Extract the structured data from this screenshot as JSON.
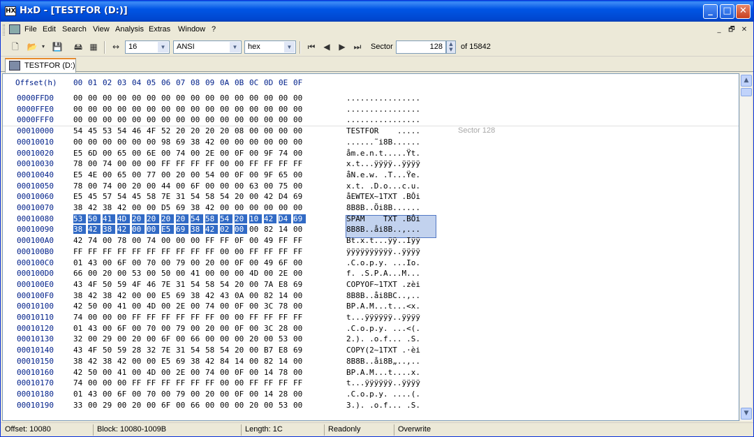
{
  "window": {
    "title": "HxD - [TESTFOR (D:)]",
    "icon": "hxd-icon",
    "app_icon_text": "HX"
  },
  "window_controls": {
    "minimize": "_",
    "maximize": "□",
    "close": "✕"
  },
  "menu": [
    "File",
    "Edit",
    "Search",
    "View",
    "Analysis",
    "Extras",
    "Window",
    "?"
  ],
  "mdi_controls": {
    "minimize": "_",
    "restore": "🗗",
    "close": "✕"
  },
  "toolbar": {
    "bytes_per_row": "16",
    "charset": "ANSI",
    "offset_base": "hex",
    "sector_label": "Sector",
    "sector_value": "128",
    "sector_total": "of 15842"
  },
  "tab": {
    "label": "TESTFOR (D:)"
  },
  "hex": {
    "offset_header": "Offset(h)",
    "columns": [
      "00",
      "01",
      "02",
      "03",
      "04",
      "05",
      "06",
      "07",
      "08",
      "09",
      "0A",
      "0B",
      "0C",
      "0D",
      "0E",
      "0F"
    ],
    "sector_marker": "Sector 128",
    "rows": [
      {
        "offset": "0000FFD0",
        "bytes": [
          "00",
          "00",
          "00",
          "00",
          "00",
          "00",
          "00",
          "00",
          "00",
          "00",
          "00",
          "00",
          "00",
          "00",
          "00",
          "00"
        ],
        "ascii": "................"
      },
      {
        "offset": "0000FFE0",
        "bytes": [
          "00",
          "00",
          "00",
          "00",
          "00",
          "00",
          "00",
          "00",
          "00",
          "00",
          "00",
          "00",
          "00",
          "00",
          "00",
          "00"
        ],
        "ascii": "................"
      },
      {
        "offset": "0000FFF0",
        "bytes": [
          "00",
          "00",
          "00",
          "00",
          "00",
          "00",
          "00",
          "00",
          "00",
          "00",
          "00",
          "00",
          "00",
          "00",
          "00",
          "00"
        ],
        "ascii": "................"
      },
      {
        "offset": "00010000",
        "bytes": [
          "54",
          "45",
          "53",
          "54",
          "46",
          "4F",
          "52",
          "20",
          "20",
          "20",
          "20",
          "08",
          "00",
          "00",
          "00",
          "00"
        ],
        "ascii": "TESTFOR    ....."
      },
      {
        "offset": "00010010",
        "bytes": [
          "00",
          "00",
          "00",
          "00",
          "00",
          "00",
          "98",
          "69",
          "38",
          "42",
          "00",
          "00",
          "00",
          "00",
          "00",
          "00"
        ],
        "ascii": "......˜i8B......"
      },
      {
        "offset": "00010020",
        "bytes": [
          "E5",
          "6D",
          "00",
          "65",
          "00",
          "6E",
          "00",
          "74",
          "00",
          "2E",
          "00",
          "0F",
          "00",
          "9F",
          "74",
          "00"
        ],
        "ascii": "åm.e.n.t.....Ÿt."
      },
      {
        "offset": "00010030",
        "bytes": [
          "78",
          "00",
          "74",
          "00",
          "00",
          "00",
          "FF",
          "FF",
          "FF",
          "FF",
          "00",
          "00",
          "FF",
          "FF",
          "FF",
          "FF"
        ],
        "ascii": "x.t...ÿÿÿÿ..ÿÿÿÿ"
      },
      {
        "offset": "00010040",
        "bytes": [
          "E5",
          "4E",
          "00",
          "65",
          "00",
          "77",
          "00",
          "20",
          "00",
          "54",
          "00",
          "0F",
          "00",
          "9F",
          "65",
          "00"
        ],
        "ascii": "åN.e.w. .T...Ÿe."
      },
      {
        "offset": "00010050",
        "bytes": [
          "78",
          "00",
          "74",
          "00",
          "20",
          "00",
          "44",
          "00",
          "6F",
          "00",
          "00",
          "00",
          "63",
          "00",
          "75",
          "00"
        ],
        "ascii": "x.t. .D.o...c.u."
      },
      {
        "offset": "00010060",
        "bytes": [
          "E5",
          "45",
          "57",
          "54",
          "45",
          "58",
          "7E",
          "31",
          "54",
          "58",
          "54",
          "20",
          "00",
          "42",
          "D4",
          "69"
        ],
        "ascii": "åEWTEX~1TXT .BÔi"
      },
      {
        "offset": "00010070",
        "bytes": [
          "38",
          "42",
          "38",
          "42",
          "00",
          "00",
          "D5",
          "69",
          "38",
          "42",
          "00",
          "00",
          "00",
          "00",
          "00",
          "00"
        ],
        "ascii": "8B8B..Õi8B......"
      },
      {
        "offset": "00010080",
        "bytes": [
          "53",
          "50",
          "41",
          "4D",
          "20",
          "20",
          "20",
          "20",
          "54",
          "58",
          "54",
          "20",
          "10",
          "42",
          "D4",
          "69"
        ],
        "ascii": "SPAM    TXT .BÔi"
      },
      {
        "offset": "00010090",
        "bytes": [
          "38",
          "42",
          "38",
          "42",
          "00",
          "00",
          "E5",
          "69",
          "38",
          "42",
          "02",
          "00",
          "00",
          "82",
          "14",
          "00"
        ],
        "ascii": "8B8B..åi8B..,..."
      },
      {
        "offset": "000100A0",
        "bytes": [
          "42",
          "74",
          "00",
          "78",
          "00",
          "74",
          "00",
          "00",
          "00",
          "FF",
          "FF",
          "0F",
          "00",
          "49",
          "FF",
          "FF"
        ],
        "ascii": "Bt.x.t...ÿÿ..Iÿÿ"
      },
      {
        "offset": "000100B0",
        "bytes": [
          "FF",
          "FF",
          "FF",
          "FF",
          "FF",
          "FF",
          "FF",
          "FF",
          "FF",
          "FF",
          "00",
          "00",
          "FF",
          "FF",
          "FF",
          "FF"
        ],
        "ascii": "ÿÿÿÿÿÿÿÿÿÿ..ÿÿÿÿ"
      },
      {
        "offset": "000100C0",
        "bytes": [
          "01",
          "43",
          "00",
          "6F",
          "00",
          "70",
          "00",
          "79",
          "00",
          "20",
          "00",
          "0F",
          "00",
          "49",
          "6F",
          "00"
        ],
        "ascii": ".C.o.p.y. ...Io."
      },
      {
        "offset": "000100D0",
        "bytes": [
          "66",
          "00",
          "20",
          "00",
          "53",
          "00",
          "50",
          "00",
          "41",
          "00",
          "00",
          "00",
          "4D",
          "00",
          "2E",
          "00"
        ],
        "ascii": "f. .S.P.A...M..."
      },
      {
        "offset": "000100E0",
        "bytes": [
          "43",
          "4F",
          "50",
          "59",
          "4F",
          "46",
          "7E",
          "31",
          "54",
          "58",
          "54",
          "20",
          "00",
          "7A",
          "E8",
          "69"
        ],
        "ascii": "COPYOF~1TXT .zèi"
      },
      {
        "offset": "000100F0",
        "bytes": [
          "38",
          "42",
          "38",
          "42",
          "00",
          "00",
          "E5",
          "69",
          "38",
          "42",
          "43",
          "0A",
          "00",
          "82",
          "14",
          "00"
        ],
        "ascii": "8B8B..åi8BC..,.."
      },
      {
        "offset": "00010100",
        "bytes": [
          "42",
          "50",
          "00",
          "41",
          "00",
          "4D",
          "00",
          "2E",
          "00",
          "74",
          "00",
          "0F",
          "00",
          "3C",
          "78",
          "00"
        ],
        "ascii": "BP.A.M...t...<x."
      },
      {
        "offset": "00010110",
        "bytes": [
          "74",
          "00",
          "00",
          "00",
          "FF",
          "FF",
          "FF",
          "FF",
          "FF",
          "FF",
          "00",
          "00",
          "FF",
          "FF",
          "FF",
          "FF"
        ],
        "ascii": "t...ÿÿÿÿÿÿ..ÿÿÿÿ"
      },
      {
        "offset": "00010120",
        "bytes": [
          "01",
          "43",
          "00",
          "6F",
          "00",
          "70",
          "00",
          "79",
          "00",
          "20",
          "00",
          "0F",
          "00",
          "3C",
          "28",
          "00"
        ],
        "ascii": ".C.o.p.y. ...<(."
      },
      {
        "offset": "00010130",
        "bytes": [
          "32",
          "00",
          "29",
          "00",
          "20",
          "00",
          "6F",
          "00",
          "66",
          "00",
          "00",
          "00",
          "20",
          "00",
          "53",
          "00"
        ],
        "ascii": "2.). .o.f... .S."
      },
      {
        "offset": "00010140",
        "bytes": [
          "43",
          "4F",
          "50",
          "59",
          "28",
          "32",
          "7E",
          "31",
          "54",
          "58",
          "54",
          "20",
          "00",
          "B7",
          "E8",
          "69"
        ],
        "ascii": "COPY(2~1TXT .·èi"
      },
      {
        "offset": "00010150",
        "bytes": [
          "38",
          "42",
          "38",
          "42",
          "00",
          "00",
          "E5",
          "69",
          "38",
          "42",
          "84",
          "14",
          "00",
          "82",
          "14",
          "00"
        ],
        "ascii": "8B8B..åi8B„..,.."
      },
      {
        "offset": "00010160",
        "bytes": [
          "42",
          "50",
          "00",
          "41",
          "00",
          "4D",
          "00",
          "2E",
          "00",
          "74",
          "00",
          "0F",
          "00",
          "14",
          "78",
          "00"
        ],
        "ascii": "BP.A.M...t....x."
      },
      {
        "offset": "00010170",
        "bytes": [
          "74",
          "00",
          "00",
          "00",
          "FF",
          "FF",
          "FF",
          "FF",
          "FF",
          "FF",
          "00",
          "00",
          "FF",
          "FF",
          "FF",
          "FF"
        ],
        "ascii": "t...ÿÿÿÿÿÿ..ÿÿÿÿ"
      },
      {
        "offset": "00010180",
        "bytes": [
          "01",
          "43",
          "00",
          "6F",
          "00",
          "70",
          "00",
          "79",
          "00",
          "20",
          "00",
          "0F",
          "00",
          "14",
          "28",
          "00"
        ],
        "ascii": ".C.o.p.y. ....(."
      },
      {
        "offset": "00010190",
        "bytes": [
          "33",
          "00",
          "29",
          "00",
          "20",
          "00",
          "6F",
          "00",
          "66",
          "00",
          "00",
          "00",
          "20",
          "00",
          "53",
          "00"
        ],
        "ascii": "3.). .o.f... .S."
      }
    ],
    "selection": {
      "start": "10080",
      "end": "1009B"
    }
  },
  "status": {
    "offset": "Offset: 10080",
    "block": "Block: 10080-1009B",
    "length": "Length: 1C",
    "mode": "Readonly",
    "insert": "Overwrite"
  },
  "colors": {
    "selection": "#316ac5",
    "offset_text": "#00208a",
    "title_bar": "#0055e5"
  }
}
